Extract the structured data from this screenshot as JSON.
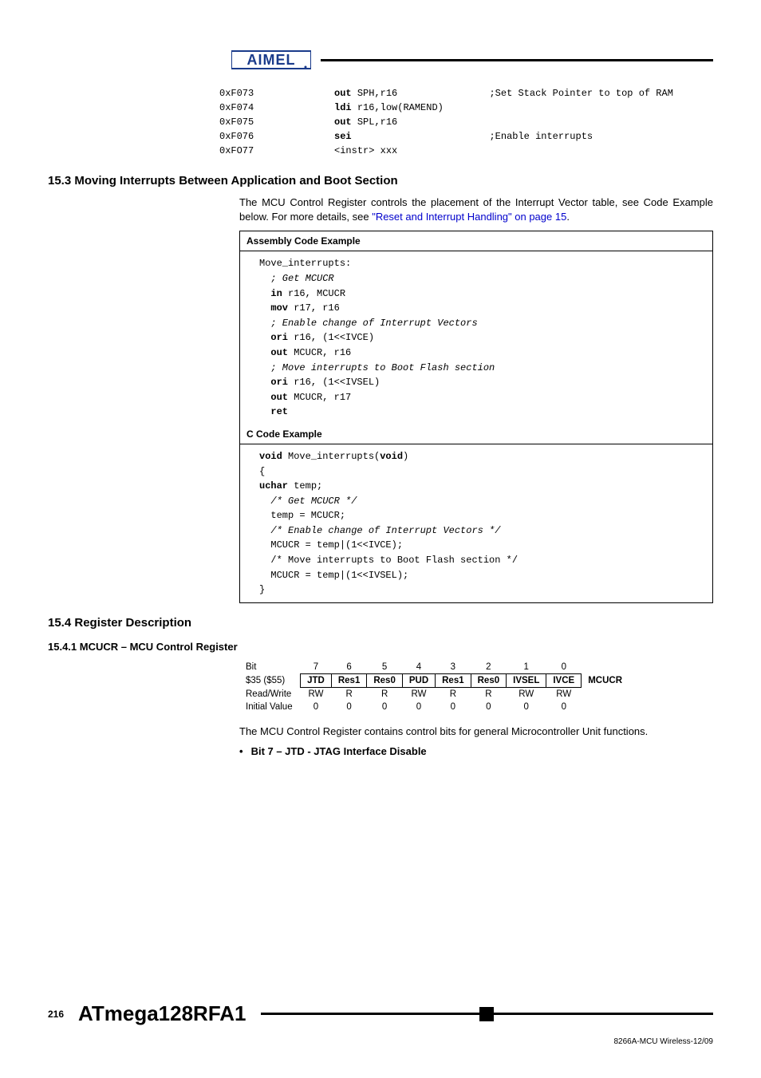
{
  "asm_pre": [
    {
      "addr": "0xF073",
      "code": "<b>out</b> SPH,r16",
      "comment": ";Set Stack Pointer to top of RAM"
    },
    {
      "addr": "0xF074",
      "code": "<b>ldi</b> r16,low(RAMEND)",
      "comment": ""
    },
    {
      "addr": "0xF075",
      "code": "<b>out</b> SPL,r16",
      "comment": ""
    },
    {
      "addr": "0xF076",
      "code": "<b>sei</b>",
      "comment": ";Enable interrupts"
    },
    {
      "addr": "0xFO77",
      "code": "&lt;instr&gt; xxx",
      "comment": ""
    }
  ],
  "sec153_title": "15.3 Moving Interrupts Between Application and Boot Section",
  "sec153_para": "The MCU Control Register controls the placement of the Interrupt Vector table, see Code Example below. For more details, see ",
  "sec153_link": "\"Reset and Interrupt Handling\" on page 15",
  "sec153_period": ".",
  "asm_box_title": "Assembly Code Example",
  "asm_box_lines": [
    "Move_interrupts:",
    "  <i>; Get MCUCR</i>",
    "  <b>in</b> r16, MCUCR",
    "  <b>mov</b> r17, r16",
    "  <i>; Enable change of Interrupt Vectors</i>",
    "  <b>ori</b> r16, (1&lt;&lt;IVCE)",
    "  <b>out</b> MCUCR, r16",
    "  <i>; Move interrupts to Boot Flash section</i>",
    "  <b>ori</b> r16, (1&lt;&lt;IVSEL)",
    "  <b>out</b> MCUCR, r17",
    "  <b>ret</b>"
  ],
  "c_box_title": "C Code Example",
  "c_box_lines": [
    "<b>void</b> Move_interrupts(<b>void</b>)",
    "{",
    "<b>uchar</b> temp;",
    "  <i>/* Get MCUCR */</i>",
    "  temp = MCUCR;",
    "  <i>/* Enable change of Interrupt Vectors */</i>",
    "  MCUCR = temp|(1&lt;&lt;IVCE);",
    "  /* Move interrupts to Boot Flash section */",
    "  MCUCR = temp|(1&lt;&lt;IVSEL);",
    "}"
  ],
  "sec154_title": "15.4 Register Description",
  "sec1541_title": "15.4.1 MCUCR – MCU Control Register",
  "reg": {
    "bit_label": "Bit",
    "bits": [
      "7",
      "6",
      "5",
      "4",
      "3",
      "2",
      "1",
      "0"
    ],
    "addr_label": "$35 ($55)",
    "fields": [
      "JTD",
      "Res1",
      "Res0",
      "PUD",
      "Res1",
      "Res0",
      "IVSEL",
      "IVCE"
    ],
    "reg_name": "MCUCR",
    "rw_label": "Read/Write",
    "rw": [
      "RW",
      "R",
      "R",
      "RW",
      "R",
      "R",
      "RW",
      "RW"
    ],
    "iv_label": "Initial Value",
    "iv": [
      "0",
      "0",
      "0",
      "0",
      "0",
      "0",
      "0",
      "0"
    ]
  },
  "reg_para": "The MCU Control Register contains control bits for general Microcontroller Unit functions.",
  "bullet_text": "Bit 7 – JTD - JTAG Interface Disable",
  "footer": {
    "page_num": "216",
    "product": "ATmega128RFA1",
    "doc_id": "8266A-MCU Wireless-12/09"
  }
}
